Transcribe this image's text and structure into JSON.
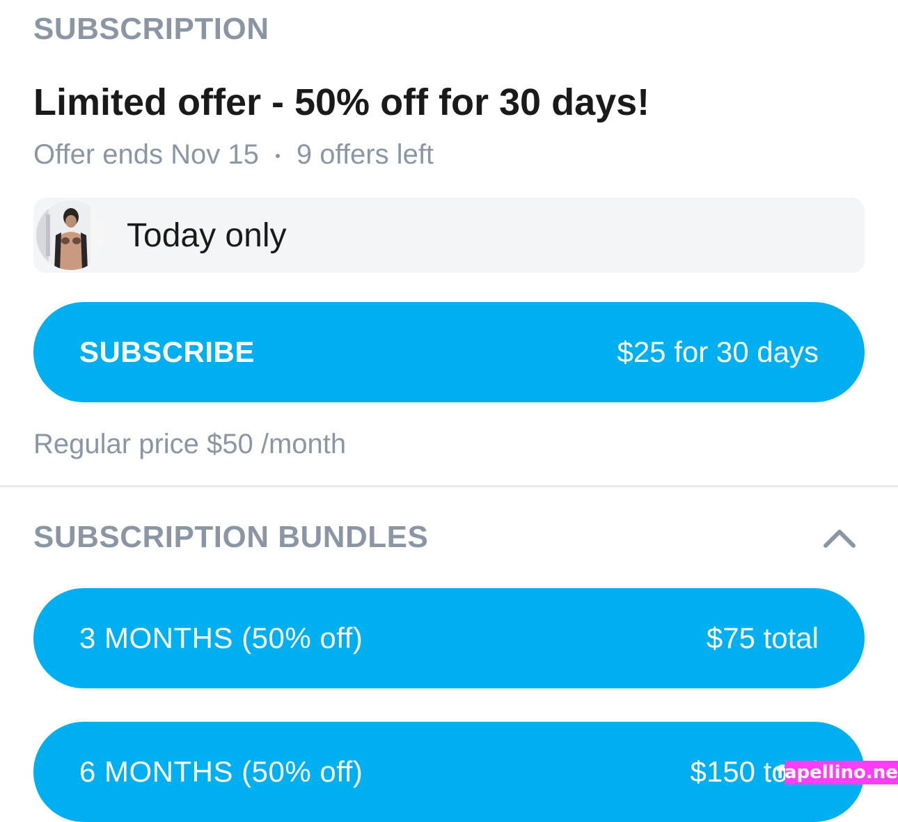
{
  "subscription": {
    "header": "SUBSCRIPTION",
    "offer_title": "Limited offer - 50% off for 30 days!",
    "offer_ends": "Offer ends Nov 15",
    "offers_left": "9 offers left",
    "today_label": "Today only",
    "subscribe_button": {
      "label": "SUBSCRIBE",
      "price": "$25 for 30 days"
    },
    "regular_price": "Regular price $50 /month"
  },
  "bundles": {
    "header": "SUBSCRIPTION BUNDLES",
    "toggle_icon": "chevron-up-icon",
    "items": [
      {
        "label": "3 MONTHS (50% off)",
        "price": "$75 total"
      },
      {
        "label": "6 MONTHS (50% off)",
        "price": "$150 total"
      }
    ]
  },
  "watermark": "fapellino.net",
  "colors": {
    "accent": "#00aff0",
    "muted_text": "#8a96a3",
    "primary_text": "#1a1a1a",
    "watermark_bg": "#ff3df5"
  }
}
